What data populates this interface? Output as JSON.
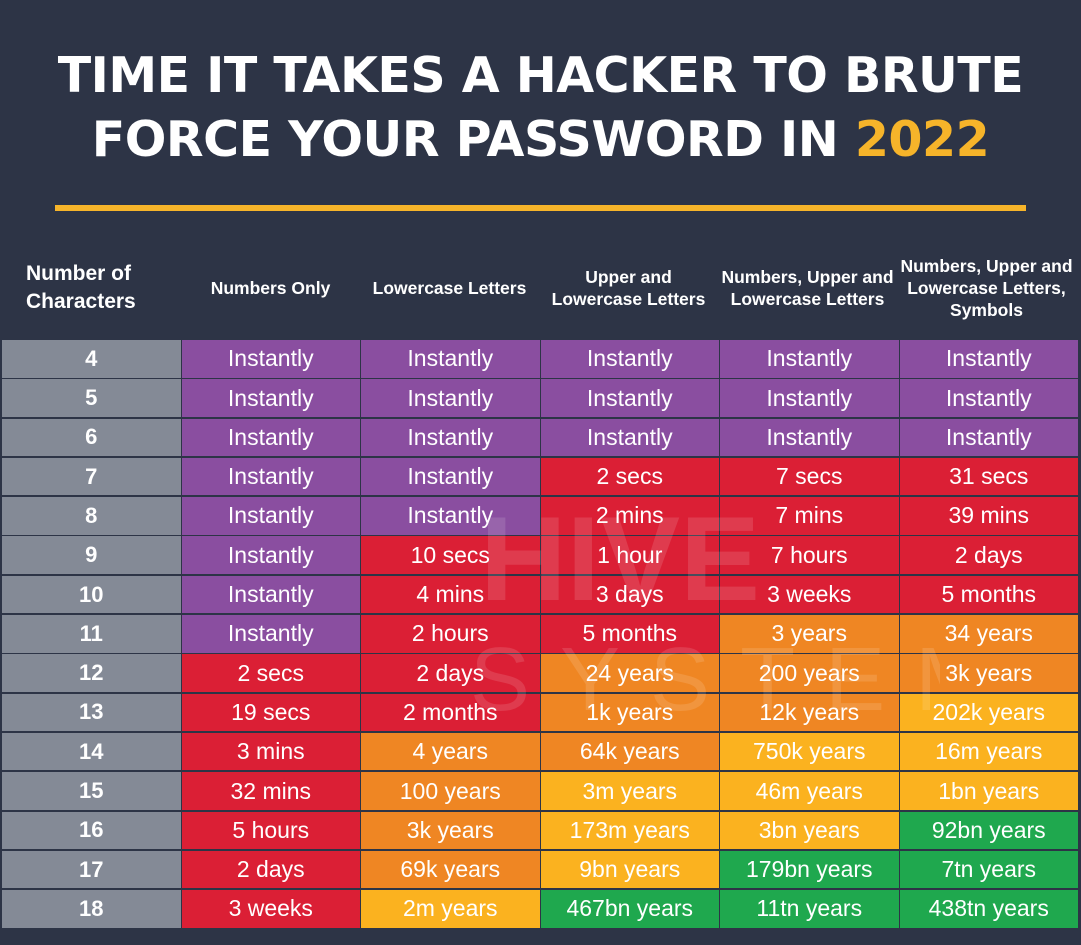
{
  "header": {
    "title_line1": "TIME IT TAKES A HACKER TO BRUTE",
    "title_line2": "FORCE YOUR PASSWORD IN",
    "title_year": "2022"
  },
  "colors": {
    "background": "#2d3446",
    "accent": "#f6b42a",
    "instantly": "#8a4ea0",
    "red": "#db1f35",
    "orange": "#ef8623",
    "yellow": "#fbb21f",
    "green": "#1fa84e",
    "rowheader": "#848a96"
  },
  "watermark": {
    "line1": "HIVE",
    "line2": "SYSTEMS"
  },
  "chart_data": {
    "type": "table",
    "title": "TIME IT TAKES A HACKER TO BRUTE FORCE YOUR PASSWORD IN 2022",
    "columns": [
      "Number of Characters",
      "Numbers Only",
      "Lowercase Letters",
      "Upper and Lowercase Letters",
      "Numbers, Upper and Lowercase Letters",
      "Numbers, Upper and Lowercase Letters, Symbols"
    ],
    "rows": [
      {
        "chars": "4",
        "values": [
          "Instantly",
          "Instantly",
          "Instantly",
          "Instantly",
          "Instantly"
        ],
        "colors": [
          "instantly",
          "instantly",
          "instantly",
          "instantly",
          "instantly"
        ]
      },
      {
        "chars": "5",
        "values": [
          "Instantly",
          "Instantly",
          "Instantly",
          "Instantly",
          "Instantly"
        ],
        "colors": [
          "instantly",
          "instantly",
          "instantly",
          "instantly",
          "instantly"
        ]
      },
      {
        "chars": "6",
        "values": [
          "Instantly",
          "Instantly",
          "Instantly",
          "Instantly",
          "Instantly"
        ],
        "colors": [
          "instantly",
          "instantly",
          "instantly",
          "instantly",
          "instantly"
        ]
      },
      {
        "chars": "7",
        "values": [
          "Instantly",
          "Instantly",
          "2 secs",
          "7 secs",
          "31 secs"
        ],
        "colors": [
          "instantly",
          "instantly",
          "red",
          "red",
          "red"
        ]
      },
      {
        "chars": "8",
        "values": [
          "Instantly",
          "Instantly",
          "2 mins",
          "7 mins",
          "39 mins"
        ],
        "colors": [
          "instantly",
          "instantly",
          "red",
          "red",
          "red"
        ]
      },
      {
        "chars": "9",
        "values": [
          "Instantly",
          "10 secs",
          "1 hour",
          "7 hours",
          "2 days"
        ],
        "colors": [
          "instantly",
          "red",
          "red",
          "red",
          "red"
        ]
      },
      {
        "chars": "10",
        "values": [
          "Instantly",
          "4 mins",
          "3 days",
          "3 weeks",
          "5 months"
        ],
        "colors": [
          "instantly",
          "red",
          "red",
          "red",
          "red"
        ]
      },
      {
        "chars": "11",
        "values": [
          "Instantly",
          "2 hours",
          "5 months",
          "3 years",
          "34 years"
        ],
        "colors": [
          "instantly",
          "red",
          "red",
          "orange",
          "orange"
        ]
      },
      {
        "chars": "12",
        "values": [
          "2 secs",
          "2 days",
          "24 years",
          "200 years",
          "3k years"
        ],
        "colors": [
          "red",
          "red",
          "orange",
          "orange",
          "orange"
        ]
      },
      {
        "chars": "13",
        "values": [
          "19 secs",
          "2 months",
          "1k years",
          "12k years",
          "202k years"
        ],
        "colors": [
          "red",
          "red",
          "orange",
          "orange",
          "yellow"
        ]
      },
      {
        "chars": "14",
        "values": [
          "3 mins",
          "4 years",
          "64k years",
          "750k years",
          "16m years"
        ],
        "colors": [
          "red",
          "orange",
          "orange",
          "yellow",
          "yellow"
        ]
      },
      {
        "chars": "15",
        "values": [
          "32 mins",
          "100 years",
          "3m years",
          "46m years",
          "1bn years"
        ],
        "colors": [
          "red",
          "orange",
          "yellow",
          "yellow",
          "yellow"
        ]
      },
      {
        "chars": "16",
        "values": [
          "5 hours",
          "3k years",
          "173m years",
          "3bn years",
          "92bn years"
        ],
        "colors": [
          "red",
          "orange",
          "yellow",
          "yellow",
          "green"
        ]
      },
      {
        "chars": "17",
        "values": [
          "2 days",
          "69k years",
          "9bn years",
          "179bn years",
          "7tn years"
        ],
        "colors": [
          "red",
          "orange",
          "yellow",
          "green",
          "green"
        ]
      },
      {
        "chars": "18",
        "values": [
          "3 weeks",
          "2m years",
          "467bn years",
          "11tn years",
          "438tn years"
        ],
        "colors": [
          "red",
          "yellow",
          "green",
          "green",
          "green"
        ]
      }
    ]
  }
}
